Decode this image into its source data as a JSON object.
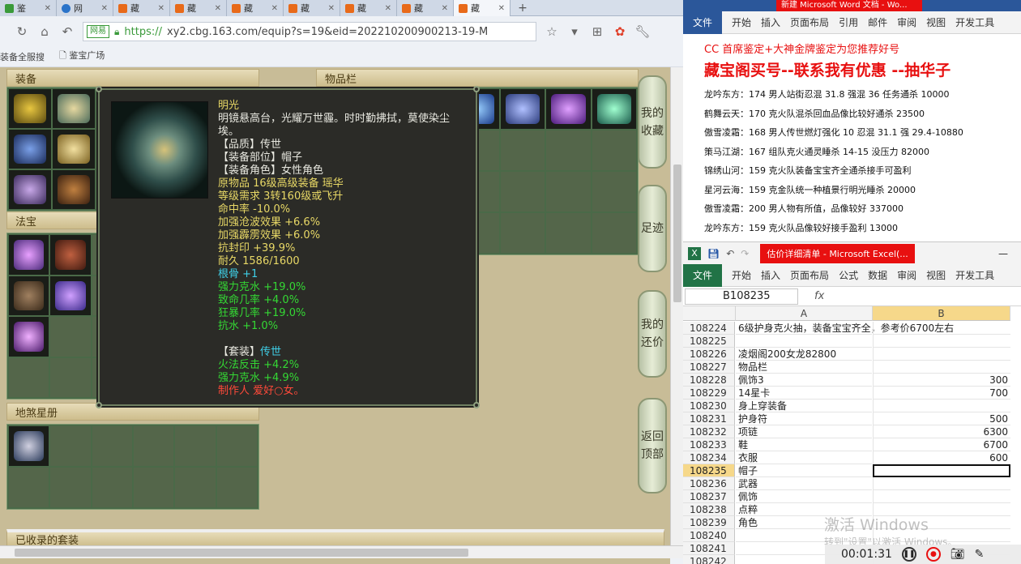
{
  "browser": {
    "tabs": [
      {
        "label": "鉴",
        "icon": "page-icon"
      },
      {
        "label": "网",
        "icon": "browser-icon"
      },
      {
        "label": "藏",
        "icon": "cbg-icon"
      },
      {
        "label": "藏",
        "icon": "cbg-icon"
      },
      {
        "label": "藏",
        "icon": "cbg-icon"
      },
      {
        "label": "藏",
        "icon": "cbg-icon"
      },
      {
        "label": "藏",
        "icon": "cbg-icon"
      },
      {
        "label": "藏",
        "icon": "cbg-icon"
      },
      {
        "label": "藏",
        "icon": "cbg-icon"
      }
    ],
    "url_badge": "网易",
    "url_https": "https://",
    "url_rest": "xy2.cbg.163.com/equip?s=19&eid=202210200900213-19-M",
    "bookmarks": [
      "装备全服搜",
      "鉴宝广场"
    ]
  },
  "game": {
    "equip_header": "装备",
    "items_header": "物品栏",
    "fabao_header": "法宝",
    "disha_header": "地煞星册",
    "suits_header": "已收录的套装",
    "side_buttons": [
      "我的收藏",
      "足迹",
      "我的还价",
      "返回顶部"
    ]
  },
  "tooltip": {
    "name": "明光",
    "desc": "明镜悬高台，光耀万世霾。时时勤拂拭，莫使染尘埃。",
    "quality": "【品质】传世",
    "slot": "【装备部位】帽子",
    "role": "【装备角色】女性角色",
    "origin": "原物品 16级高级装备 瑶华",
    "level_req": "等级需求 3转160级或飞升",
    "hit": "命中率 -10.0%",
    "stat1": "加强沧波效果 +6.6%",
    "stat2": "加强霹雳效果 +6.0%",
    "stat3": "抗封印 +39.9%",
    "durability": "耐久 1586/1600",
    "bone": "根骨 +1",
    "g1": "强力克水 +19.0%",
    "g2": "致命几率 +4.0%",
    "g3": "狂暴几率 +19.0%",
    "g4": "抗水 +1.0%",
    "set_label": "【套装】",
    "set_name": "传世",
    "s1": "火法反击 +4.2%",
    "s2": "强力克水 +4.9%",
    "maker": "制作人 爱好○女。"
  },
  "word": {
    "title": "新建 Microsoft Word 文档 - Wo...",
    "ribbon": [
      "文件",
      "开始",
      "插入",
      "页面布局",
      "引用",
      "邮件",
      "审阅",
      "视图",
      "开发工具"
    ],
    "head1": "CC 首席鉴定+大神金牌鉴定为您推荐好号",
    "head2": "藏宝阁买号--联系我有优惠 --抽华子",
    "lines": [
      "龙吟东方：174 男人站街忍混 31.8 强混 36 任务通杀 10000",
      "鹤舞云天：170 克火队混杀回血品像比较好通杀 23500",
      "傲雪凌霜：168 男人传世燃灯强化 10 忍混 31.1 强 29.4-10880",
      "策马江湖：167 组队克火通灵睡杀 14-15 没压力 82000",
      "锦绣山河：159 克火队装备宝宝齐全通杀接手可盈利",
      "星河云海：159 克金队统一种植景行明光睡杀 20000",
      "傲雪凌霜：200 男人物有所值，品像较好 337000",
      "龙吟东方：159 克火队品像较好接手盈利 13000"
    ]
  },
  "excel": {
    "title": "估价详细清单 - Microsoft Excel(...",
    "ribbon": [
      "文件",
      "开始",
      "插入",
      "页面布局",
      "公式",
      "数据",
      "审阅",
      "视图",
      "开发工具"
    ],
    "namebox": "B108235",
    "fx": "fx",
    "col_a": "A",
    "col_b": "B",
    "rows": [
      {
        "n": "108224",
        "a": "6级护身克火抽，装备宝宝齐全，参考价6700左右",
        "b": ""
      },
      {
        "n": "108225",
        "a": "",
        "b": ""
      },
      {
        "n": "108226",
        "a": "凌烟阁200女龙82800",
        "b": ""
      },
      {
        "n": "108227",
        "a": "物品栏",
        "b": ""
      },
      {
        "n": "108228",
        "a": "佩饰3",
        "b": "300"
      },
      {
        "n": "108229",
        "a": "14星卡",
        "b": "700"
      },
      {
        "n": "108230",
        "a": "身上穿装备",
        "b": ""
      },
      {
        "n": "108231",
        "a": "护身符",
        "b": "500"
      },
      {
        "n": "108232",
        "a": "项链",
        "b": "6300"
      },
      {
        "n": "108233",
        "a": "鞋",
        "b": "6700"
      },
      {
        "n": "108234",
        "a": "衣服",
        "b": "600"
      },
      {
        "n": "108235",
        "a": "帽子",
        "b": ""
      },
      {
        "n": "108236",
        "a": "武器",
        "b": ""
      },
      {
        "n": "108237",
        "a": "佩饰",
        "b": ""
      },
      {
        "n": "108238",
        "a": "点粹",
        "b": ""
      },
      {
        "n": "108239",
        "a": "角色",
        "b": ""
      },
      {
        "n": "108240",
        "a": "",
        "b": ""
      },
      {
        "n": "108241",
        "a": "",
        "b": ""
      },
      {
        "n": "108242",
        "a": "",
        "b": ""
      }
    ],
    "selected_row": "108235"
  },
  "watermark": {
    "line1": "激活 Windows",
    "line2": "转到\"设置\"以激活 Windows。"
  },
  "recorder": {
    "time": "00:01:31"
  }
}
